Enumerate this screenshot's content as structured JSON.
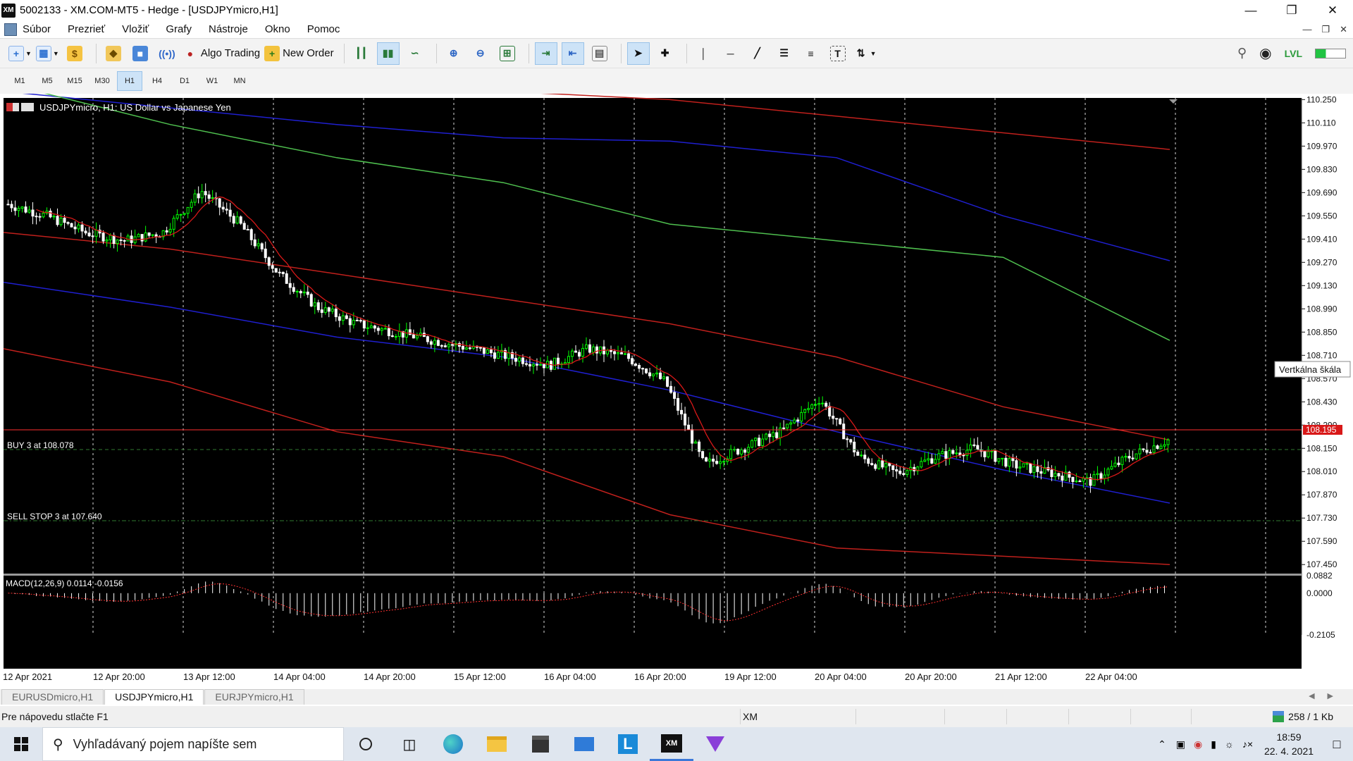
{
  "window": {
    "app_icon": "XM",
    "title": "5002133 - XM.COM-MT5 - Hedge - [USDJPYmicro,H1]",
    "minimize_icon": "minimize-icon",
    "restore_icon": "restore-icon",
    "close_icon": "close-icon"
  },
  "menu": {
    "items": [
      "Súbor",
      "Prezrieť",
      "Vložiť",
      "Grafy",
      "Nástroje",
      "Okno",
      "Pomoc"
    ]
  },
  "toolbar": {
    "algo_trading": "Algo Trading",
    "new_order": "New Order"
  },
  "timeframes": {
    "items": [
      "M1",
      "M5",
      "M15",
      "M30",
      "H1",
      "H4",
      "D1",
      "W1",
      "MN"
    ],
    "active": "H1"
  },
  "chart": {
    "header": "USDJPYmicro, H1:  US Dollar vs Japanese Yen",
    "price_labels": [
      "110.250",
      "110.110",
      "109.970",
      "109.830",
      "109.690",
      "109.550",
      "109.410",
      "109.270",
      "109.130",
      "108.990",
      "108.850",
      "108.710",
      "108.570",
      "108.430",
      "108.290",
      "108.150",
      "108.010",
      "107.870",
      "107.730",
      "107.590",
      "107.450"
    ],
    "current_price": "108.195",
    "tooltip": "Vertkálna škála",
    "order_buy": "BUY 3 at 108.078",
    "order_sellstop": "SELL STOP 3 at 107.640",
    "macd_label": "MACD(12,26,9) 0.0114 -0.0156",
    "macd_scale": [
      "0.0882",
      "0.0000",
      "-0.2105"
    ],
    "time_labels": [
      "12 Apr 2021",
      "12 Apr 20:00",
      "13 Apr 12:00",
      "14 Apr 04:00",
      "14 Apr 20:00",
      "15 Apr 12:00",
      "16 Apr 04:00",
      "16 Apr 20:00",
      "19 Apr 12:00",
      "20 Apr 04:00",
      "20 Apr 20:00",
      "21 Apr 12:00",
      "22 Apr 04:00"
    ],
    "colors": {
      "background": "#000000",
      "bull_candle": "#00ff00",
      "bear_candle": "#ffffff",
      "band_outer": "#c0201c",
      "band_middle": "#4fc04f",
      "band_inner": "#1f1fd0",
      "ma_fast": "#d81818",
      "price_line": "#ff3030",
      "order_line": "#2f7a2f",
      "grid": "#d8d8d8"
    }
  },
  "chart_data": {
    "type": "candlestick",
    "symbol": "USDJPYmicro",
    "timeframe": "H1",
    "title": "USDJPYmicro, H1:  US Dollar vs Japanese Yen",
    "ylim": [
      107.4,
      110.26
    ],
    "x_ticks": [
      "12 Apr 2021",
      "12 Apr 20:00",
      "13 Apr 12:00",
      "14 Apr 04:00",
      "14 Apr 20:00",
      "15 Apr 12:00",
      "16 Apr 04:00",
      "16 Apr 20:00",
      "19 Apr 12:00",
      "20 Apr 04:00",
      "20 Apr 20:00",
      "21 Apr 12:00",
      "22 Apr 04:00"
    ],
    "close_path": [
      109.62,
      109.55,
      109.45,
      109.4,
      109.45,
      109.7,
      109.5,
      109.2,
      109.0,
      108.9,
      108.85,
      108.8,
      108.75,
      108.7,
      108.65,
      108.75,
      108.7,
      108.55,
      108.05,
      108.15,
      108.25,
      108.45,
      108.1,
      108.0,
      108.1,
      108.15,
      108.05,
      108.0,
      107.95,
      108.1,
      108.2
    ],
    "bands": {
      "outer_upper": [
        110.65,
        110.5,
        110.35,
        110.3,
        110.25,
        110.15,
        110.05,
        109.95
      ],
      "middle_upper": [
        110.35,
        110.1,
        109.9,
        109.75,
        109.5,
        109.4,
        109.3,
        108.8
      ],
      "inner_upper": [
        110.3,
        110.2,
        110.1,
        110.02,
        110.0,
        109.9,
        109.55,
        109.28
      ],
      "middle": [
        109.45,
        109.35,
        109.2,
        109.05,
        108.9,
        108.7,
        108.4,
        108.2
      ],
      "inner_lower": [
        109.15,
        109.0,
        108.82,
        108.7,
        108.5,
        108.25,
        108.02,
        107.82
      ],
      "outer_lower": [
        108.75,
        108.55,
        108.25,
        108.1,
        107.75,
        107.55,
        107.5,
        107.45
      ]
    },
    "macd": {
      "value": 0.0114,
      "signal": -0.0156,
      "ylim": [
        -0.2105,
        0.0882
      ]
    },
    "orders": [
      {
        "type": "BUY",
        "volume": 3,
        "price": 108.078
      },
      {
        "type": "SELL STOP",
        "volume": 3,
        "price": 107.64
      }
    ],
    "bid": 108.195
  },
  "tabs": {
    "items": [
      "EURUSDmicro,H1",
      "USDJPYmicro,H1",
      "EURJPYmicro,H1"
    ],
    "active": "USDJPYmicro,H1"
  },
  "status": {
    "help": "Pre nápovedu stlačte F1",
    "server": "XM",
    "traffic": "258 / 1 Kb"
  },
  "taskbar": {
    "search_placeholder": "Vyhľadávaný pojem napíšte sem",
    "time": "18:59",
    "date": "22. 4. 2021"
  }
}
